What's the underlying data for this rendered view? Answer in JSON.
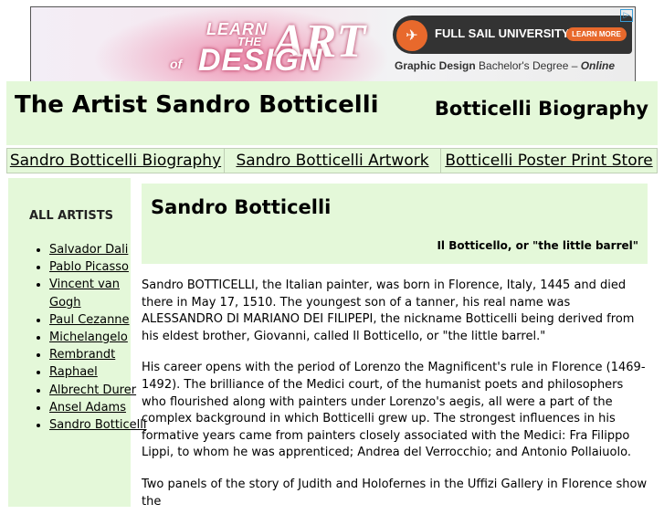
{
  "ad": {
    "headline_1": "LEARN",
    "headline_2": "THE",
    "headline_3": "ART",
    "headline_4": "of",
    "headline_5": "DESIGN",
    "school": "FULL SAIL UNIVERSITY.",
    "cta": "LEARN MORE",
    "degree_prefix": "Graphic Design",
    "degree_mid": " Bachelor's Degree – ",
    "degree_suffix": "Online",
    "adchoices_icon": "adchoices-icon",
    "logo_icon": "plane-icon"
  },
  "header": {
    "title": "The Artist Sandro Botticelli",
    "subtitle": "Botticelli Biography"
  },
  "nav": [
    {
      "label": "Sandro Botticelli Biography"
    },
    {
      "label": "Sandro Botticelli Artwork"
    },
    {
      "label": "Botticelli Poster Print Store"
    }
  ],
  "sidebar": {
    "heading": "ALL ARTISTS",
    "items": [
      {
        "label": "Salvador Dali"
      },
      {
        "label": "Pablo Picasso"
      },
      {
        "label": "Vincent van Gogh"
      },
      {
        "label": "Paul Cezanne"
      },
      {
        "label": "Michelangelo"
      },
      {
        "label": "Rembrandt"
      },
      {
        "label": "Raphael"
      },
      {
        "label": "Albrecht Durer"
      },
      {
        "label": "Ansel Adams"
      },
      {
        "label": "Sandro Botticelli"
      }
    ]
  },
  "main": {
    "title": "Sandro Botticelli",
    "nickname": "Il Botticello, or \"the little barrel\"",
    "paragraphs": [
      "Sandro BOTTICELLI, the Italian painter, was born in Florence, Italy, 1445 and died there in May 17, 1510. The youngest son of a tanner, his real name was ALESSANDRO DI MARIANO DEI FILIPEPI, the nickname Botticelli being derived from his eldest brother, Giovanni, called Il Botticello, or \"the little barrel.\"",
      "His career opens with the period of Lorenzo the Magnificent's rule in Florence (1469-1492). The brilliance of the Medici court, of the humanist poets and philosophers who flourished along with painters under Lorenzo's aegis, all were a part of the complex background in which Botticelli grew up. The strongest influences in his formative years came from painters closely associated with the Medici: Fra Filippo Lippi, to whom he was apprenticed; Andrea del Verrocchio; and Antonio Pollaiuolo.",
      "Two panels of the story of Judith and Holofernes in the Uffizi Gallery in Florence show the"
    ]
  },
  "colors": {
    "panel_bg": "#e4f8d9",
    "ad_accent": "#e8692c"
  }
}
